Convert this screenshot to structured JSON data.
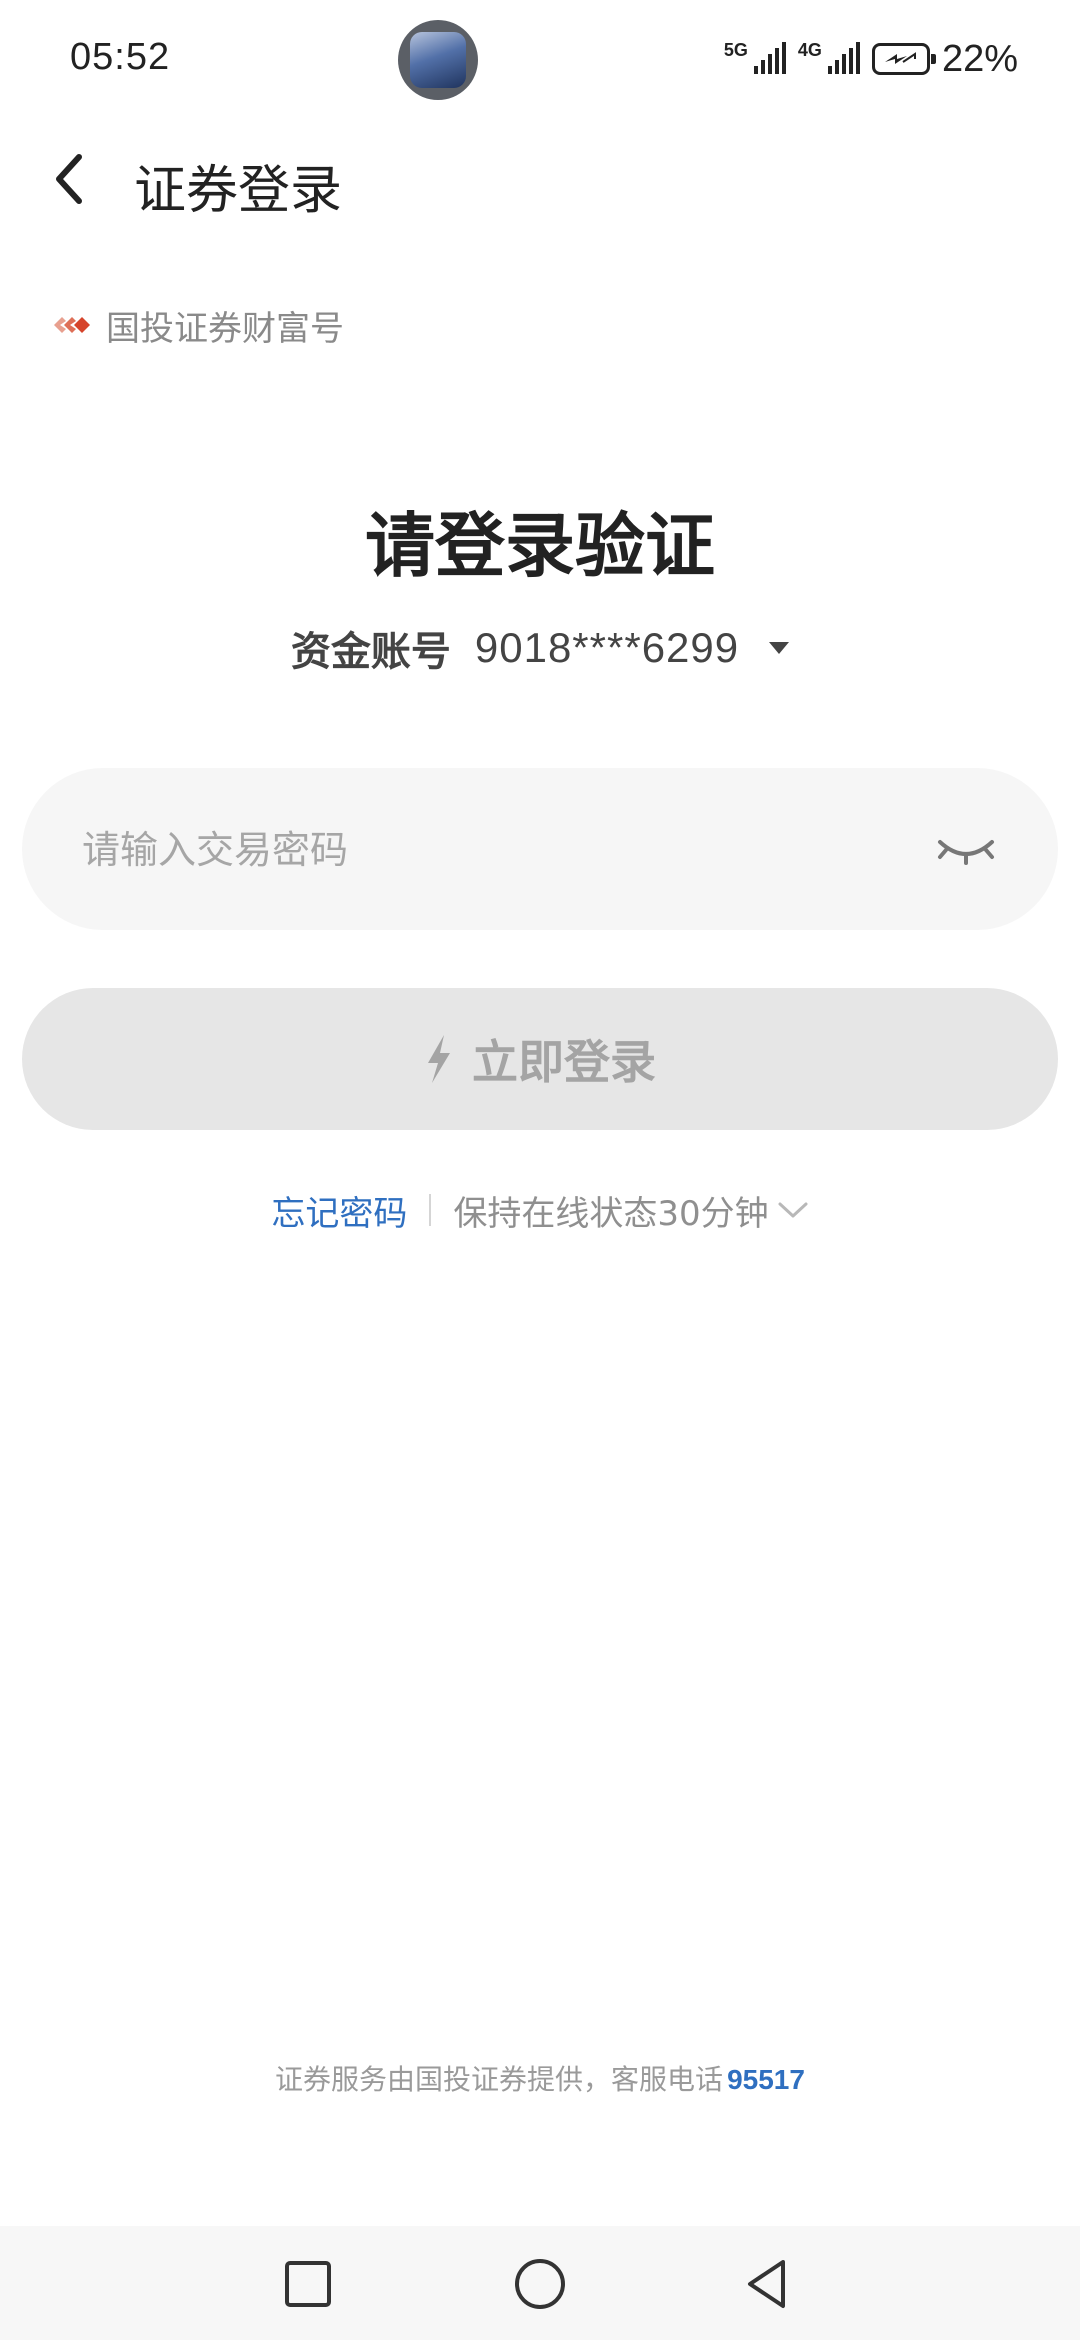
{
  "status_bar": {
    "time": "05:52",
    "network_1": "5G",
    "network_2": "4G",
    "battery_percent": "22%",
    "battery_charging": true
  },
  "header": {
    "title": "证券登录",
    "back_icon": "chevron-left-icon"
  },
  "brand": {
    "text": "国投证券财富号",
    "logo_color": "#d6442b"
  },
  "login": {
    "headline": "请登录验证",
    "account_label": "资金账号",
    "account_number": "9018****6299",
    "password_placeholder": "请输入交易密码",
    "password_value": "",
    "password_visibility_icon": "eye-closed-icon",
    "login_button_label": "立即登录",
    "login_button_icon": "lightning-icon",
    "forgot_password": "忘记密码",
    "keep_online": "保持在线状态30分钟"
  },
  "footer": {
    "note": "证券服务由国投证券提供，客服电话",
    "phone": "95517"
  },
  "colors": {
    "link": "#2f6fc0",
    "button_disabled_bg": "#e6e6e6",
    "input_bg": "#f6f6f6"
  },
  "nav_bar": {
    "items": [
      "recent-apps-icon",
      "home-icon",
      "back-icon"
    ]
  }
}
